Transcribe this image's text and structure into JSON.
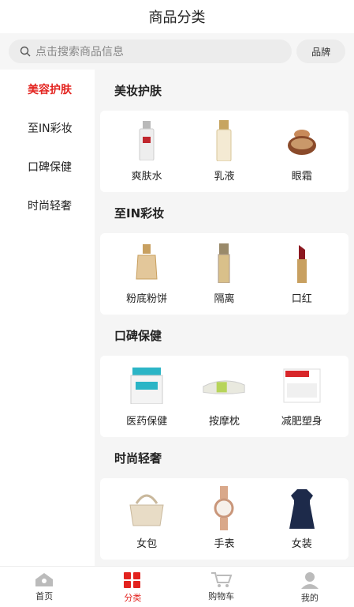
{
  "header": {
    "title": "商品分类"
  },
  "search": {
    "placeholder": "点击搜索商品信息",
    "brand_label": "品牌"
  },
  "sidebar": {
    "items": [
      {
        "label": "美容护肤",
        "active": true
      },
      {
        "label": "至IN彩妆",
        "active": false
      },
      {
        "label": "口碑保健",
        "active": false
      },
      {
        "label": "时尚轻奢",
        "active": false
      }
    ]
  },
  "sections": [
    {
      "title": "美妆护肤",
      "products": [
        "爽肤水",
        "乳液",
        "眼霜"
      ]
    },
    {
      "title": "至IN彩妆",
      "products": [
        "粉底粉饼",
        "隔离",
        "口红"
      ]
    },
    {
      "title": "口碑保健",
      "products": [
        "医药保健",
        "按摩枕",
        "减肥塑身"
      ]
    },
    {
      "title": "时尚轻奢",
      "products": [
        "女包",
        "手表",
        "女装"
      ]
    }
  ],
  "tabbar": {
    "items": [
      {
        "label": "首页",
        "icon": "home-icon"
      },
      {
        "label": "分类",
        "icon": "category-icon",
        "active": true
      },
      {
        "label": "购物车",
        "icon": "cart-icon"
      },
      {
        "label": "我的",
        "icon": "profile-icon"
      }
    ]
  },
  "colors": {
    "accent": "#e3231f",
    "background": "#f5f5f5"
  }
}
